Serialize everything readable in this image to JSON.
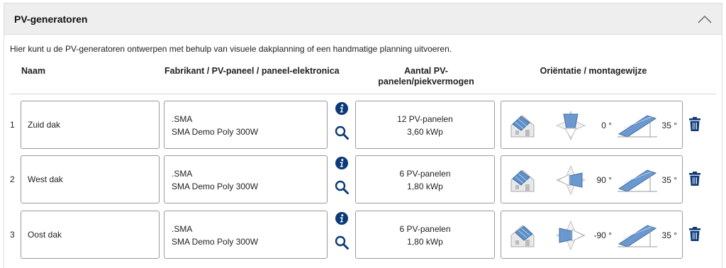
{
  "header": {
    "title": "PV-generatoren",
    "collapse_icon": "chevron-up-icon"
  },
  "intro": "Hier kunt u de PV-generatoren ontwerpen met behulp van visuele dakplanning of een handmatige planning uitvoeren.",
  "columns": {
    "name": "Naam",
    "manufacturer": "Fabrikant / PV-paneel / paneel-elektronica",
    "count_line1": "Aantal PV-",
    "count_line2": "panelen/piekvermogen",
    "orientation": "Oriëntatie / montagewijze"
  },
  "colors": {
    "icon_blue": "#0b3a78",
    "panel_blue": "#5d8fc8",
    "header_bg": "#eeeeee"
  },
  "rows": [
    {
      "num": "1",
      "name": "Zuid dak",
      "manufacturer": ".SMA",
      "panel": "SMA Demo Poly 300W",
      "count": "12 PV-panelen",
      "power": "3,60 kWp",
      "azimuth": "0 °",
      "tilt": "35 °"
    },
    {
      "num": "2",
      "name": "West dak",
      "manufacturer": ".SMA",
      "panel": "SMA Demo Poly 300W",
      "count": "6 PV-panelen",
      "power": "1,80 kWp",
      "azimuth": "90 °",
      "tilt": "35 °"
    },
    {
      "num": "3",
      "name": "Oost dak",
      "manufacturer": ".SMA",
      "panel": "SMA Demo Poly 300W",
      "count": "6 PV-panelen",
      "power": "1,80 kWp",
      "azimuth": "-90 °",
      "tilt": "35 °"
    }
  ]
}
